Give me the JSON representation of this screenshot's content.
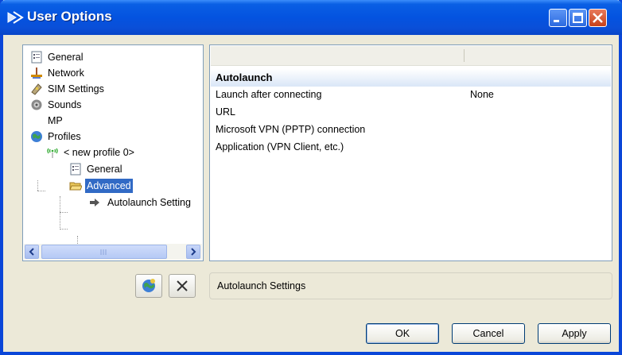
{
  "window": {
    "title": "User Options"
  },
  "tree": {
    "items": [
      {
        "label": "General",
        "icon": "settings-list-icon"
      },
      {
        "label": "Network",
        "icon": "network-icon"
      },
      {
        "label": "SIM Settings",
        "icon": "sim-card-icon"
      },
      {
        "label": "Sounds",
        "icon": "speaker-icon"
      },
      {
        "label": "MP",
        "icon": ""
      },
      {
        "label": "Profiles",
        "icon": "globe-icon"
      },
      {
        "label": "< new profile 0>",
        "icon": "wireless-icon"
      },
      {
        "label": "General",
        "icon": "settings-list-icon"
      },
      {
        "label": "Advanced",
        "icon": "open-folder-icon",
        "selected": true
      },
      {
        "label": "Autolaunch Setting",
        "icon": "arrow-icon"
      }
    ]
  },
  "list": {
    "group_title": "Autolaunch",
    "rows": [
      {
        "label": "Launch after connecting",
        "value": "None"
      },
      {
        "label": "URL",
        "value": ""
      },
      {
        "label": "Microsoft VPN (PPTP) connection",
        "value": ""
      },
      {
        "label": "Application (VPN Client, etc.)",
        "value": ""
      }
    ]
  },
  "status": {
    "text": "Autolaunch Settings"
  },
  "buttons": {
    "ok": "OK",
    "cancel": "Cancel",
    "apply": "Apply"
  },
  "colors": {
    "titlebar": "#0453e0",
    "selection": "#316ac5"
  }
}
